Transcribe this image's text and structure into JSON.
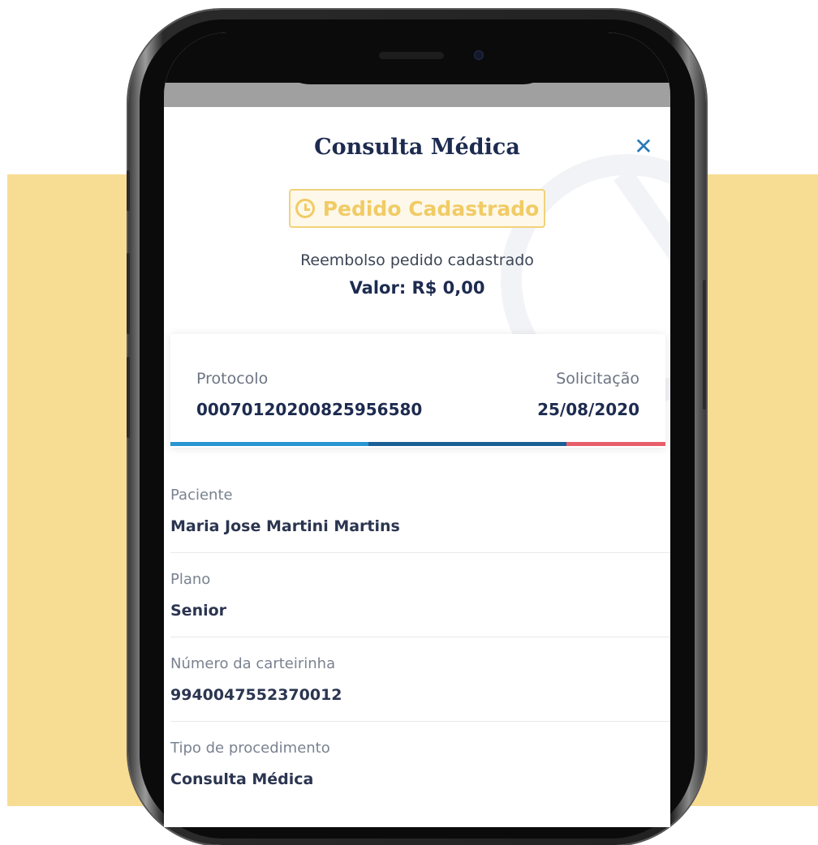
{
  "modal": {
    "title": "Consulta Médica",
    "close_icon": "close-icon",
    "status_badge": {
      "label": "Pedido Cadastrado",
      "icon": "clock-icon",
      "color": "#f1cb65"
    },
    "status_description": "Reembolso pedido cadastrado",
    "value_text": "Valor: R$ 0,00"
  },
  "summary_card": {
    "protocol_label": "Protocolo",
    "protocol_value": "00070120200825956580",
    "request_label": "Solicitação",
    "request_value": "25/08/2020",
    "progress_colors": [
      "#2796d2",
      "#1b5f95",
      "#e85d6a"
    ]
  },
  "fields": [
    {
      "label": "Paciente",
      "value": "Maria Jose Martini Martins"
    },
    {
      "label": "Plano",
      "value": "Senior"
    },
    {
      "label": "Número da carteirinha",
      "value": "9940047552370012"
    },
    {
      "label": "Tipo de procedimento",
      "value": "Consulta Médica"
    }
  ],
  "colors": {
    "backdrop": "#f7dd94",
    "title": "#1d2b4f",
    "accent": "#2a7bb7"
  }
}
